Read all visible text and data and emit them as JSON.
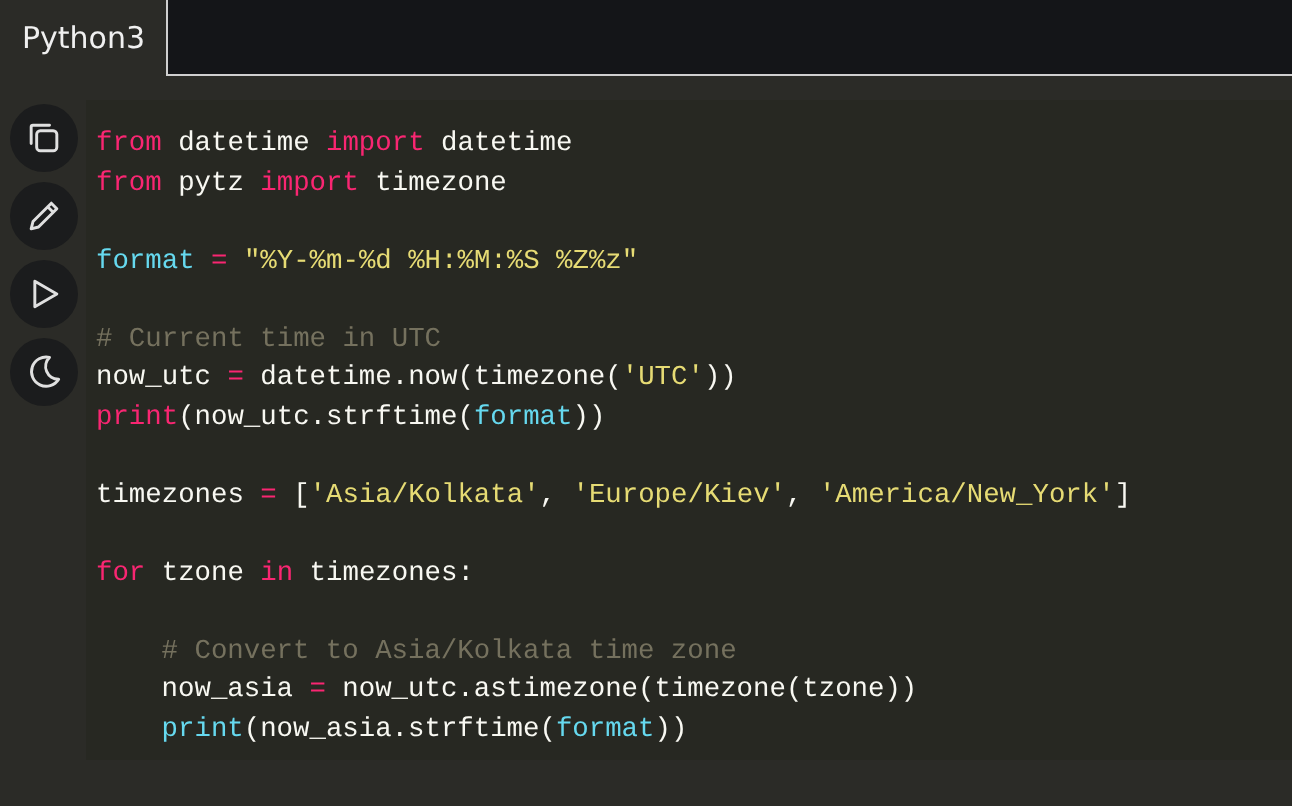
{
  "tabs": [
    {
      "label": "Python3",
      "selected": true
    }
  ],
  "toolbar": [
    {
      "kind": "copy"
    },
    {
      "kind": "edit"
    },
    {
      "kind": "run"
    },
    {
      "kind": "theme"
    }
  ],
  "code": {
    "lines": [
      {
        "kind": "code",
        "tokens": [
          {
            "kind": "keyword",
            "text": "from"
          },
          {
            "kind": "plain",
            "text": " datetime "
          },
          {
            "kind": "keyword",
            "text": "import"
          },
          {
            "kind": "plain",
            "text": " datetime"
          }
        ]
      },
      {
        "kind": "code",
        "tokens": [
          {
            "kind": "keyword",
            "text": "from"
          },
          {
            "kind": "plain",
            "text": " pytz "
          },
          {
            "kind": "keyword",
            "text": "import"
          },
          {
            "kind": "plain",
            "text": " timezone"
          }
        ]
      },
      {
        "kind": "blank"
      },
      {
        "kind": "code",
        "tokens": [
          {
            "kind": "builtin",
            "text": "format"
          },
          {
            "kind": "operator",
            "text": " = "
          },
          {
            "kind": "string",
            "text": "\"%Y-%m-%d %H:%M:%S %Z%z\""
          }
        ]
      },
      {
        "kind": "blank"
      },
      {
        "kind": "code",
        "tokens": [
          {
            "kind": "comment",
            "text": "# Current time in UTC"
          }
        ]
      },
      {
        "kind": "code",
        "tokens": [
          {
            "kind": "plain",
            "text": "now_utc "
          },
          {
            "kind": "operator",
            "text": "="
          },
          {
            "kind": "plain",
            "text": " datetime.now(timezone("
          },
          {
            "kind": "string",
            "text": "'UTC'"
          },
          {
            "kind": "plain",
            "text": "))"
          }
        ]
      },
      {
        "kind": "code",
        "tokens": [
          {
            "kind": "keyword",
            "text": "print"
          },
          {
            "kind": "plain",
            "text": "(now_utc.strftime("
          },
          {
            "kind": "builtin",
            "text": "format"
          },
          {
            "kind": "plain",
            "text": "))"
          }
        ]
      },
      {
        "kind": "blank"
      },
      {
        "kind": "code",
        "tokens": [
          {
            "kind": "plain",
            "text": "timezones "
          },
          {
            "kind": "operator",
            "text": "="
          },
          {
            "kind": "plain",
            "text": " ["
          },
          {
            "kind": "string",
            "text": "'Asia/Kolkata'"
          },
          {
            "kind": "plain",
            "text": ", "
          },
          {
            "kind": "string",
            "text": "'Europe/Kiev'"
          },
          {
            "kind": "plain",
            "text": ", "
          },
          {
            "kind": "string",
            "text": "'America/New_York'"
          },
          {
            "kind": "plain",
            "text": "]"
          }
        ]
      },
      {
        "kind": "blank"
      },
      {
        "kind": "code",
        "tokens": [
          {
            "kind": "keyword",
            "text": "for"
          },
          {
            "kind": "plain",
            "text": " tzone "
          },
          {
            "kind": "keyword",
            "text": "in"
          },
          {
            "kind": "plain",
            "text": " timezones:"
          }
        ],
        "children": [
          {
            "kind": "blank"
          },
          {
            "kind": "code",
            "tokens": [
              {
                "kind": "comment",
                "text": "# Convert to Asia/Kolkata time zone"
              }
            ]
          },
          {
            "kind": "code",
            "tokens": [
              {
                "kind": "plain",
                "text": "now_asia "
              },
              {
                "kind": "operator",
                "text": "="
              },
              {
                "kind": "plain",
                "text": " now_utc.astimezone(timezone(tzone))"
              }
            ]
          },
          {
            "kind": "code",
            "tokens": [
              {
                "kind": "builtin",
                "text": "print"
              },
              {
                "kind": "plain",
                "text": "(now_asia.strftime("
              },
              {
                "kind": "builtin",
                "text": "format"
              },
              {
                "kind": "plain",
                "text": "))"
              }
            ]
          }
        ]
      }
    ]
  }
}
